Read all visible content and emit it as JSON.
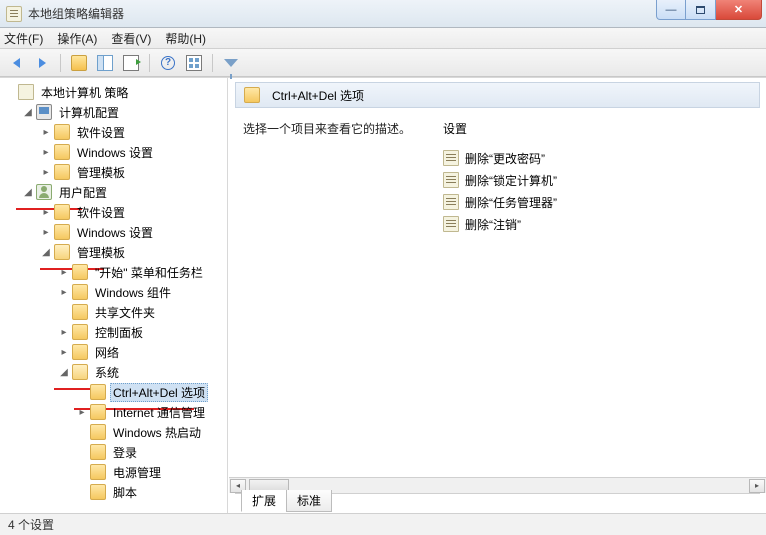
{
  "window": {
    "title": "本地组策略编辑器"
  },
  "menu": {
    "file": "文件(F)",
    "action": "操作(A)",
    "view": "查看(V)",
    "help": "帮助(H)"
  },
  "tree": {
    "root": "本地计算机 策略",
    "computer_config": "计算机配置",
    "cc_software": "软件设置",
    "cc_windows": "Windows 设置",
    "cc_admin": "管理模板",
    "user_config": "用户配置",
    "uc_software": "软件设置",
    "uc_windows": "Windows 设置",
    "uc_admin": "管理模板",
    "start_taskbar": "\"开始\" 菜单和任务栏",
    "win_components": "Windows 组件",
    "shared_folders": "共享文件夹",
    "control_panel": "控制面板",
    "network": "网络",
    "system": "系统",
    "ctrl_alt_del": "Ctrl+Alt+Del 选项",
    "internet_comm": "Internet 通信管理",
    "win_hotstart": "Windows 热启动",
    "logon": "登录",
    "power": "电源管理",
    "scripts": "脚本"
  },
  "right": {
    "header": "Ctrl+Alt+Del 选项",
    "desc": "选择一个项目来查看它的描述。",
    "settings_header": "设置",
    "items": [
      "删除“更改密码”",
      "删除“锁定计算机”",
      "删除“任务管理器”",
      "删除“注销”"
    ],
    "tabs": {
      "extended": "扩展",
      "standard": "标准"
    }
  },
  "status": "4 个设置"
}
